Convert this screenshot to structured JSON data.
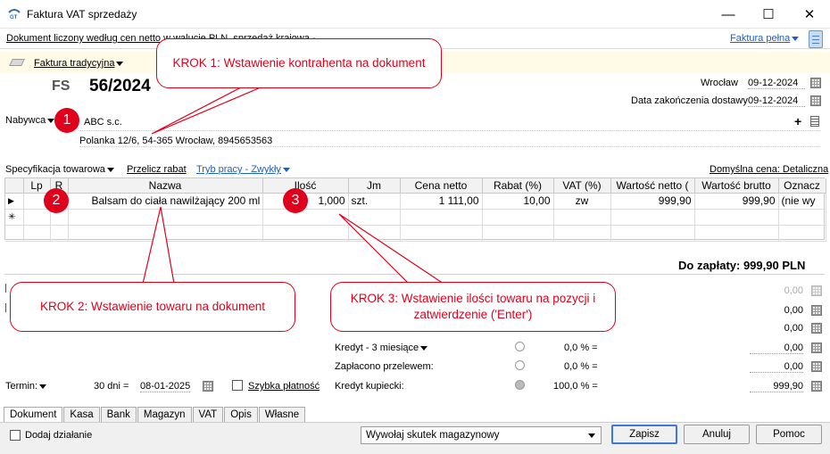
{
  "window": {
    "title": "Faktura VAT sprzedaży",
    "minimize": "—",
    "maximize": "☐",
    "close": "✕"
  },
  "info": {
    "text": "Dokument liczony według cen netto w walucie PLN, sprzedaż krajowa - S",
    "full_invoice": "Faktura pełna"
  },
  "header": {
    "invoice_type": "Faktura tradycyjna",
    "doc_prefix": "FS",
    "doc_number": "56/2024",
    "city": "Wrocław",
    "issue_date": "09-12-2024",
    "delivery_label": "Data zakończenia dostawy",
    "delivery_date": "09-12-2024"
  },
  "buyer": {
    "label": "Nabywca",
    "name": "ABC s.c.",
    "address": "Polanka  12/6, 54-365 Wrocław, 8945653563",
    "plus": "+"
  },
  "toolbar": {
    "spec": "Specyfikacja towarowa",
    "recalc": "Przelicz rabat",
    "mode": "Tryb pracy - Zwykły",
    "default_price": "Domyślna cena: Detaliczna"
  },
  "grid": {
    "headers": [
      "",
      "Lp",
      "R",
      "Nazwa",
      "Ilość",
      "Jm",
      "Cena netto",
      "Rabat (%)",
      "VAT (%)",
      "Wartość netto (",
      "Wartość brutto",
      "Oznacz"
    ],
    "row": {
      "marker": "▶",
      "name": "Balsam do ciała nawilżający 200 ml",
      "qty": "1,000",
      "unit": "szt.",
      "net_price": "1 111,00",
      "discount": "10,00",
      "vat": "zw",
      "net_value": "999,90",
      "gross_value": "999,90",
      "mark": "(nie wy"
    },
    "new_marker": "✳"
  },
  "total": "Do zapłaty: 999,90 PLN",
  "callouts": {
    "step1": "KROK 1: Wstawienie kontrahenta na dokument",
    "step2": "KROK 2: Wstawienie towaru na dokument",
    "step3": "KROK 3: Wstawienie ilości towaru na pozycji i zatwierdzenie ('Enter')",
    "badge1": "1",
    "badge2": "2",
    "badge3": "3"
  },
  "payments": {
    "rows": [
      {
        "label": "",
        "percent": "",
        "amount": "0,00",
        "disabled": true
      },
      {
        "label": "",
        "percent": "",
        "amount": "0,00"
      },
      {
        "label": "",
        "percent": "",
        "amount": "0,00"
      },
      {
        "label": "Kredyt - 3 miesiące",
        "percent": "0,0 % =",
        "amount": "0,00"
      },
      {
        "label": "Zapłacono przelewem:",
        "percent": "0,0 % =",
        "amount": "0,00"
      },
      {
        "label": "Kredyt kupiecki:",
        "percent": "100,0 % =",
        "amount": "999,90"
      }
    ],
    "term_label": "Termin:",
    "term_days": "30 dni =",
    "term_date": "08-01-2025",
    "quick_pay": "Szybka płatność"
  },
  "tabs": [
    "Dokument",
    "Kasa",
    "Bank",
    "Magazyn",
    "VAT",
    "Opis",
    "Własne"
  ],
  "footer": {
    "add_action": "Dodaj działanie",
    "warehouse_effect": "Wywołaj skutek magazynowy",
    "save": "Zapisz",
    "cancel": "Anuluj",
    "help": "Pomoc"
  },
  "colors": {
    "callout": "#e0001b",
    "link": "#1f5fbf"
  }
}
